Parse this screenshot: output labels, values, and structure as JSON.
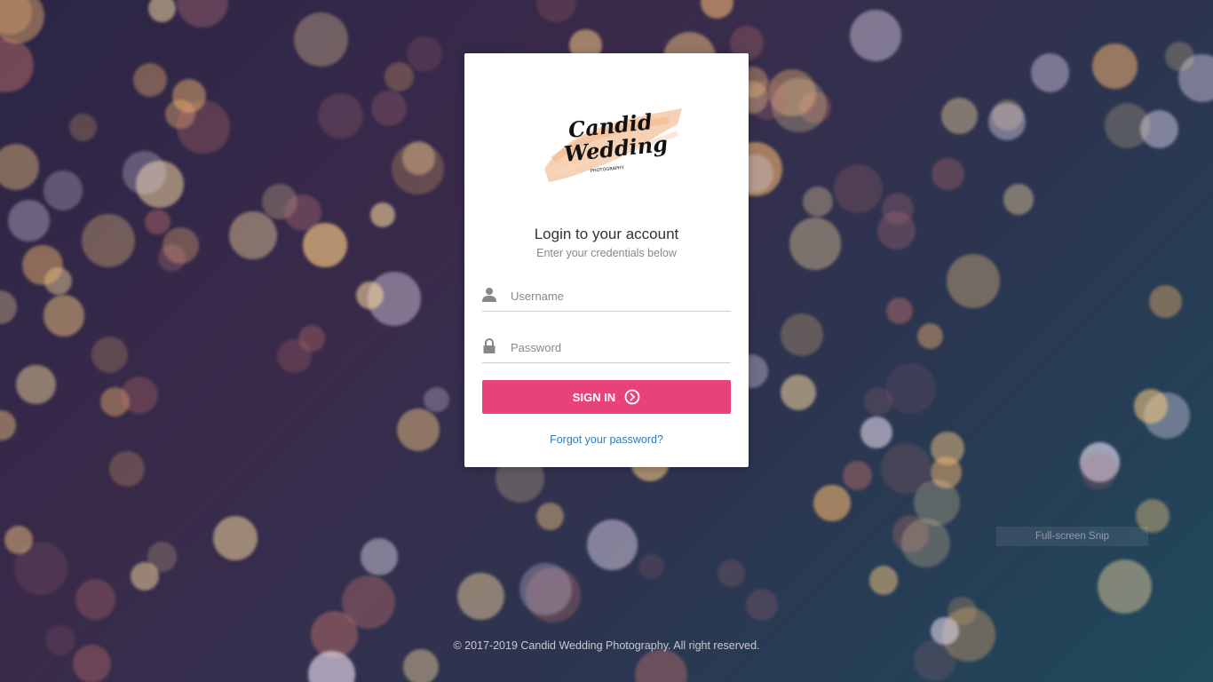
{
  "login": {
    "title": "Login to your account",
    "subtitle": "Enter your credentials below",
    "username_placeholder": "Username",
    "password_placeholder": "Password",
    "signin_label": "SIGN IN",
    "forgot_label": "Forgot your password?"
  },
  "logo": {
    "line1": "Candid",
    "line2": "Wedding",
    "tagline": "PHOTOGRAPHY"
  },
  "footer": {
    "copyright": "© 2017-2019 Candid Wedding Photography. All right reserved."
  },
  "overlay": {
    "snip_label": "Full-screen Snip"
  },
  "icons": {
    "user": "user-icon",
    "lock": "lock-icon",
    "arrow": "arrow-circle-right-icon"
  },
  "colors": {
    "accent": "#e84378",
    "link": "#2f7bbf"
  }
}
